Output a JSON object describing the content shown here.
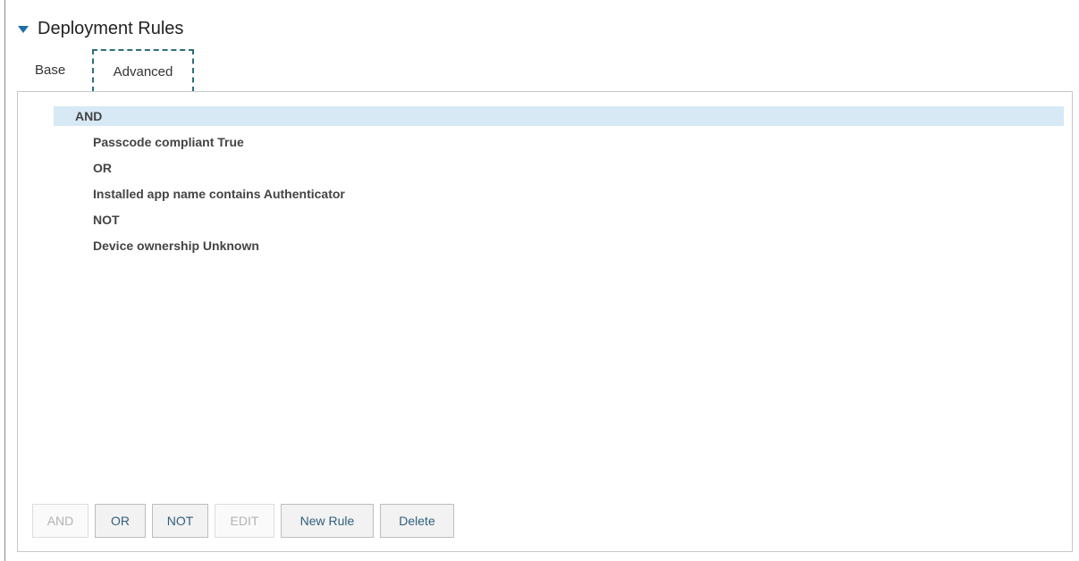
{
  "section": {
    "title": "Deployment Rules"
  },
  "tabs": [
    {
      "label": "Base",
      "selected": false
    },
    {
      "label": "Advanced",
      "selected": true
    }
  ],
  "rule_tree": {
    "root": {
      "label": "AND",
      "selected": true
    },
    "children": [
      {
        "label": "Passcode compliant True"
      },
      {
        "label": "OR"
      },
      {
        "label": "Installed app name contains Authenticator"
      },
      {
        "label": "NOT"
      },
      {
        "label": "Device ownership Unknown"
      }
    ]
  },
  "buttons": [
    {
      "label": "AND",
      "enabled": false
    },
    {
      "label": "OR",
      "enabled": true
    },
    {
      "label": "NOT",
      "enabled": true
    },
    {
      "label": "EDIT",
      "enabled": false
    },
    {
      "label": "New Rule",
      "enabled": true
    },
    {
      "label": "Delete",
      "enabled": true
    }
  ],
  "colors": {
    "accent": "#1e6fa8",
    "selection": "#d6e9f5",
    "focus_outline": "#2b6f7a"
  },
  "icons": {
    "section_toggle": "caret-down-icon"
  }
}
